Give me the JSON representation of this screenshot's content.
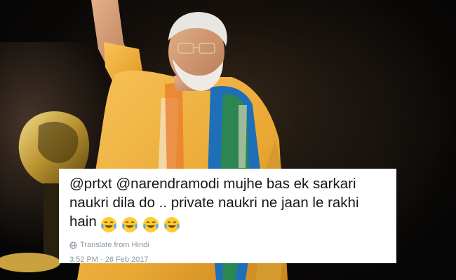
{
  "photo": {
    "description_icon": "person-waving-photo-icon"
  },
  "tweet": {
    "text": "@prtxt @narendramodi mujhe bas ek sarkari naukri dila do .. private naukri ne jaan le rakhi hain",
    "emojis": [
      "face-with-tears-of-joy-icon",
      "face-with-tears-of-joy-icon",
      "face-with-tears-of-joy-icon",
      "face-with-tears-of-joy-icon"
    ],
    "translate_label": "Translate from Hindi",
    "timestamp": "3:52 PM - 26 Feb 2017"
  },
  "colors": {
    "card_bg": "#ffffff",
    "text": "#14171a",
    "muted": "#8899a6",
    "kurta": "#f2b23e",
    "scarf_blue": "#1f6fb8",
    "scarf_green": "#2e8b3e"
  }
}
